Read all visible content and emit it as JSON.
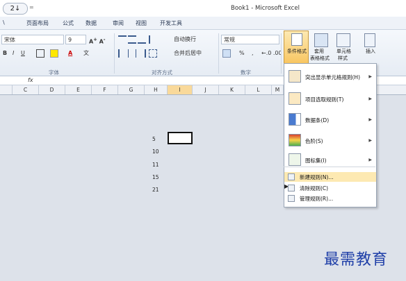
{
  "window": {
    "title": "Book1 - Microsoft Excel",
    "qat_label": "2↓",
    "qat_drop": "="
  },
  "tabs": [
    {
      "label": "\\"
    },
    {
      "label": "页面布局"
    },
    {
      "label": "公式"
    },
    {
      "label": "数据"
    },
    {
      "label": "审阅"
    },
    {
      "label": "视图"
    },
    {
      "label": "开发工具"
    }
  ],
  "ribbon": {
    "font_name": "宋体",
    "font_size": "9",
    "wrap_text": "自动换行",
    "merge_center": "合并后居中",
    "number_format": "常规",
    "percent": "%",
    "comma": ",",
    "groups": {
      "font": "字体",
      "alignment": "对齐方式",
      "number": "数字"
    },
    "conditional_format": "条件格式",
    "apply_style": "套用",
    "table_format": "表格格式",
    "cell_style_1": "单元格",
    "cell_style_2": "样式",
    "insert": "插入"
  },
  "formula_bar": {
    "fx": "fx"
  },
  "columns": [
    "C",
    "D",
    "E",
    "F",
    "G",
    "H",
    "I",
    "J",
    "K",
    "L",
    "M"
  ],
  "cells": [
    {
      "col": "H",
      "row": 1,
      "value": "5"
    },
    {
      "col": "H",
      "row": 2,
      "value": "10"
    },
    {
      "col": "H",
      "row": 3,
      "value": "11"
    },
    {
      "col": "H",
      "row": 4,
      "value": "15"
    },
    {
      "col": "H",
      "row": 5,
      "value": "21"
    }
  ],
  "menu": {
    "items": [
      {
        "label": "突出显示单元格规则(H)",
        "icon": "highlight-rules-icon"
      },
      {
        "label": "项目选取规则(T)",
        "icon": "top-bottom-icon"
      },
      {
        "label": "数据条(D)",
        "icon": "data-bars-icon"
      },
      {
        "label": "色阶(S)",
        "icon": "color-scale-icon"
      },
      {
        "label": "图标集(I)",
        "icon": "icon-sets-icon"
      }
    ],
    "small_items": [
      {
        "label": "新建规则(N)..."
      },
      {
        "label": "清除规则(C)"
      },
      {
        "label": "管理规则(R)..."
      }
    ]
  },
  "watermark": "最需教育",
  "colors": {
    "accent": "#f8c35b",
    "menu_hover": "#fde9b2",
    "watermark": "#1f3fa8"
  }
}
